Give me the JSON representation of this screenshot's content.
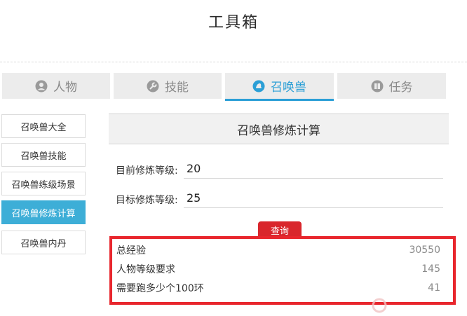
{
  "page_title": "工具箱",
  "tabs": [
    {
      "label": "人物",
      "icon": "person-icon",
      "active": false
    },
    {
      "label": "技能",
      "icon": "wrench-icon",
      "active": false
    },
    {
      "label": "召唤兽",
      "icon": "pet-icon",
      "active": true
    },
    {
      "label": "任务",
      "icon": "book-icon",
      "active": false
    }
  ],
  "sidebar": {
    "items": [
      {
        "label": "召唤兽大全",
        "active": false
      },
      {
        "label": "召唤兽技能",
        "active": false
      },
      {
        "label": "召唤兽练级场景",
        "active": false
      },
      {
        "label": "召唤兽修炼计算",
        "active": true
      },
      {
        "label": "召唤兽内丹",
        "active": false
      }
    ]
  },
  "main": {
    "header": "召唤兽修炼计算",
    "current_level": {
      "label": "目前修炼等级:",
      "value": "20"
    },
    "target_level": {
      "label": "目标修炼等级:",
      "value": "25"
    },
    "query_label": "查询",
    "results": [
      {
        "label": "总经验",
        "value": "30550"
      },
      {
        "label": "人物等级要求",
        "value": "145"
      },
      {
        "label": "需要跑多少个100环",
        "value": "41"
      }
    ]
  },
  "colors": {
    "accent": "#2b9fd6",
    "active_sidebar": "#3daed7",
    "highlight_red": "#e8262d"
  }
}
